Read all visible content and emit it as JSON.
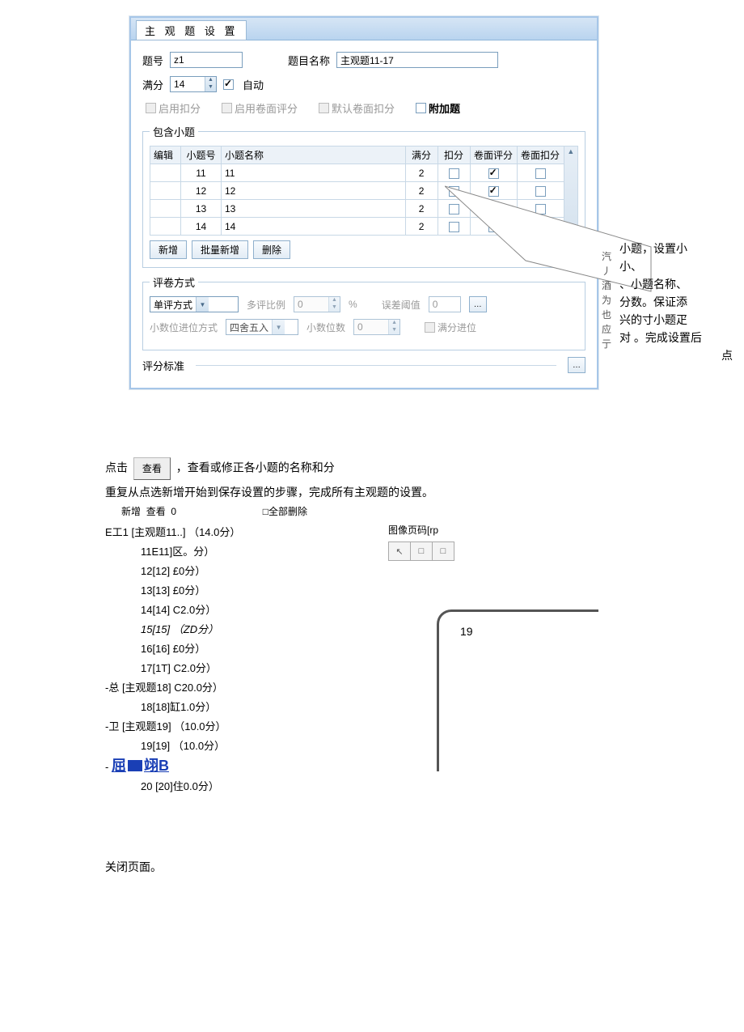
{
  "dialog": {
    "title": "主 观 题 设 置",
    "fields": {
      "id_label": "题号",
      "id_value": "z1",
      "name_label": "题目名称",
      "name_value": "主观题11-17",
      "full_label": "满分",
      "full_value": "14",
      "auto_label": "自动",
      "enable_deduct": "启用扣分",
      "enable_paper_score": "启用卷面评分",
      "default_paper_deduct": "默认卷面扣分",
      "attach_q": "附加题"
    },
    "subq_group": "包含小题",
    "table": {
      "headers": {
        "edit": "编辑",
        "num": "小题号",
        "name": "小题名称",
        "full": "满分",
        "deduct": "扣分",
        "paper_score": "卷面评分",
        "paper_deduct": "卷面扣分"
      },
      "rows": [
        {
          "num": "11",
          "name": "11",
          "full": "2",
          "deduct": false,
          "paper_score": true,
          "paper_deduct": false
        },
        {
          "num": "12",
          "name": "12",
          "full": "2",
          "deduct": false,
          "paper_score": true,
          "paper_deduct": false
        },
        {
          "num": "13",
          "name": "13",
          "full": "2",
          "deduct": false,
          "paper_score": true,
          "paper_deduct": false
        },
        {
          "num": "14",
          "name": "14",
          "full": "2",
          "deduct": false,
          "paper_score": false,
          "paper_deduct": false
        }
      ]
    },
    "buttons": {
      "add": "新增",
      "batch_add": "批量新增",
      "delete": "删除"
    },
    "eval_group": "评卷方式",
    "eval": {
      "mode": "单评方式",
      "ratio_label": "多评比例",
      "ratio_value": "0",
      "pct": "%",
      "thresh_label": "误差阈值",
      "thresh_value": "0",
      "round_label": "小数位进位方式",
      "round_mode": "四舍五入",
      "dec_label": "小数位数",
      "dec_value": "0",
      "full_carry": "满分进位"
    },
    "score_std": "评分标准"
  },
  "callout": {
    "l1": "小题，设置小",
    "l2": "小、",
    "l3": "、小题名称、",
    "l4": "分数。保证添",
    "l5": "兴的寸小题疋",
    "l6": "对 。完成设置后",
    "l7": "点"
  },
  "doc": {
    "line_click": "点击",
    "view_btn": "查看",
    "line_click_rest": "，查看或修正各小题的名称和分",
    "line_repeat": "重复从点选新增开始到保存设置的步骤，完成所有主观题的设置。",
    "toolbar": {
      "add": "新增",
      "view": "查看",
      "zero": "0",
      "del_all": "□全部删除"
    },
    "tree": {
      "g1": "E工1 [主观题11..] （14.0分）",
      "g1_items": [
        "11E11]区。分）",
        "12[12] £0分）",
        "13[13] £0分）",
        "14[14] C2.0分）",
        "15[15] （ZD分）",
        "16[16] £0分）",
        "17[1T] C2.0分）"
      ],
      "g2": "-总 [主观题18] C20.0分）",
      "g2_items": [
        "18[18]缸1.0分）"
      ],
      "g3": "-卫 [主观题19] （10.0分）",
      "g3_items": [
        "19[19] （10.0分）"
      ],
      "g4_pre": "-",
      "g4_a": "屈 ",
      "g4_b": "翊B",
      "g4_items": [
        "20 [20]住0.0分）"
      ]
    },
    "right": {
      "page_label": "图像页码[rp",
      "cursor": "↖",
      "label_19": "19"
    },
    "close": "关闭页面。"
  },
  "side_chars": [
    "汽",
    "丿",
    "酒",
    "为",
    "也",
    "应",
    "亍"
  ]
}
